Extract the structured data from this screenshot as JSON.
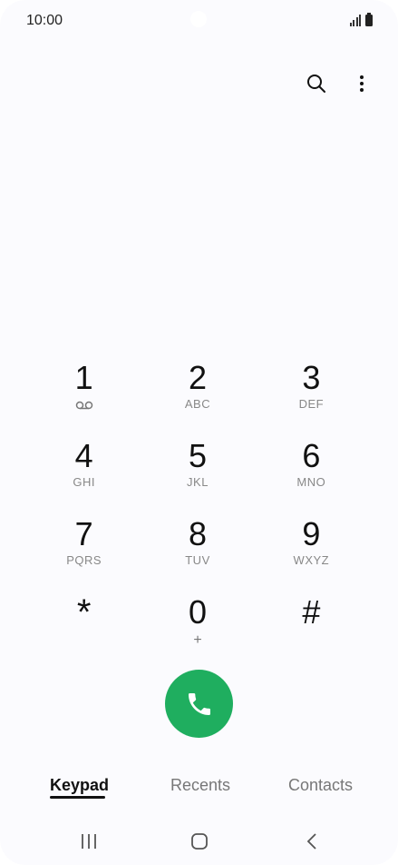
{
  "status_bar": {
    "time": "10:00",
    "signal_icon": "signal-icon",
    "battery_icon": "battery-icon"
  },
  "top_actions": {
    "search_icon": "search-icon",
    "more_icon": "more-vertical-icon"
  },
  "keypad": {
    "keys": [
      {
        "digit": "1",
        "letters": "",
        "icon": "voicemail-icon"
      },
      {
        "digit": "2",
        "letters": "ABC"
      },
      {
        "digit": "3",
        "letters": "DEF"
      },
      {
        "digit": "4",
        "letters": "GHI"
      },
      {
        "digit": "5",
        "letters": "JKL"
      },
      {
        "digit": "6",
        "letters": "MNO"
      },
      {
        "digit": "7",
        "letters": "PQRS"
      },
      {
        "digit": "8",
        "letters": "TUV"
      },
      {
        "digit": "9",
        "letters": "WXYZ"
      },
      {
        "digit": "*",
        "letters": ""
      },
      {
        "digit": "0",
        "letters": "+"
      },
      {
        "digit": "#",
        "letters": ""
      }
    ]
  },
  "call_button": {
    "icon": "phone-icon",
    "color": "#1fae5f"
  },
  "tabs": [
    {
      "label": "Keypad",
      "active": true
    },
    {
      "label": "Recents",
      "active": false
    },
    {
      "label": "Contacts",
      "active": false
    }
  ],
  "nav_bar": {
    "recents_icon": "recent-apps-icon",
    "home_icon": "home-icon",
    "back_icon": "back-icon"
  }
}
